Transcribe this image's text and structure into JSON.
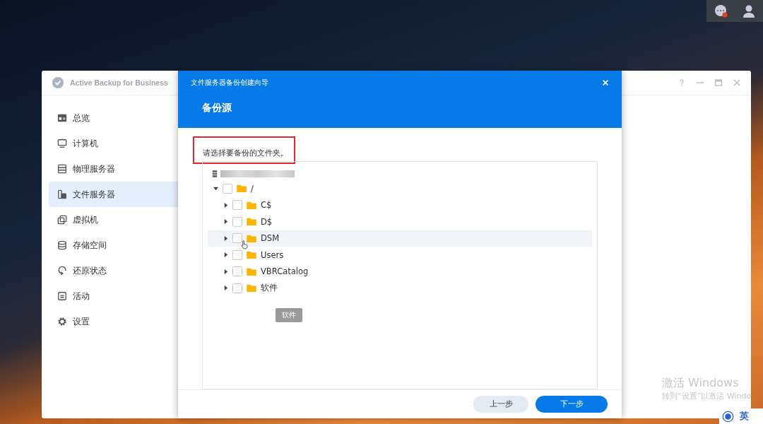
{
  "app_window": {
    "title": "Active Backup for Business",
    "sidebar": {
      "items": [
        {
          "label": "总览",
          "selected": false
        },
        {
          "label": "计算机",
          "selected": false
        },
        {
          "label": "物理服务器",
          "selected": false
        },
        {
          "label": "文件服务器",
          "selected": true
        },
        {
          "label": "虚拟机",
          "selected": false
        },
        {
          "label": "存储空间",
          "selected": false
        },
        {
          "label": "还原状态",
          "selected": false
        },
        {
          "label": "活动",
          "selected": false
        },
        {
          "label": "设置",
          "selected": false
        }
      ]
    }
  },
  "dialog": {
    "title": "文件服务器备份创建向导",
    "step": "备份源",
    "instruction": "请选择要备份的文件夹。",
    "tree": [
      {
        "label": "/",
        "expanded": true,
        "checked": false,
        "children": [
          {
            "label": "C$",
            "expanded": false,
            "checked": false,
            "hovered": false
          },
          {
            "label": "D$",
            "expanded": false,
            "checked": false,
            "hovered": false
          },
          {
            "label": "DSM",
            "expanded": false,
            "checked": false,
            "hovered": true
          },
          {
            "label": "Users",
            "expanded": false,
            "checked": false,
            "hovered": false
          },
          {
            "label": "VBRCatalog",
            "expanded": false,
            "checked": false,
            "hovered": false
          },
          {
            "label": "软件",
            "expanded": false,
            "checked": false,
            "hovered": false
          }
        ]
      }
    ],
    "tooltip": "软件",
    "buttons": [
      {
        "label": "上一步",
        "kind": "secondary"
      },
      {
        "label": "下一步",
        "kind": "primary"
      }
    ]
  },
  "activation": {
    "title": "激活 Windows",
    "subtitle": "转到“设置”以激活 Windo"
  },
  "ime": {
    "label": "英"
  }
}
